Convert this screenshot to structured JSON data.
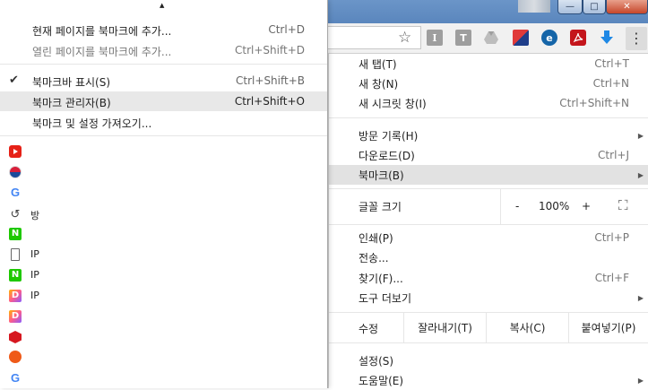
{
  "main_menu": {
    "items": [
      {
        "label": "새 탭(T)",
        "shortcut": "Ctrl+T"
      },
      {
        "label": "새 창(N)",
        "shortcut": "Ctrl+N"
      },
      {
        "label": "새 시크릿 창(I)",
        "shortcut": "Ctrl+Shift+N"
      },
      {
        "label": "방문 기록(H)",
        "shortcut": ""
      },
      {
        "label": "다운로드(D)",
        "shortcut": "Ctrl+J"
      },
      {
        "label": "북마크(B)",
        "shortcut": ""
      }
    ],
    "zoom": {
      "label": "글꼴 크기",
      "minus": "-",
      "value": "100%",
      "plus": "+",
      "fullscreen": "⛶"
    },
    "items2": [
      {
        "label": "인쇄(P)",
        "shortcut": "Ctrl+P"
      },
      {
        "label": "전송...",
        "shortcut": ""
      },
      {
        "label": "찾기(F)...",
        "shortcut": "Ctrl+F"
      },
      {
        "label": "도구 더보기",
        "shortcut": ""
      }
    ],
    "edit": {
      "label": "수정",
      "cut": "잘라내기(T)",
      "copy": "복사(C)",
      "paste": "붙여넣기(P)"
    },
    "items3": [
      {
        "label": "설정(S)"
      },
      {
        "label": "도움말(E)"
      }
    ]
  },
  "bookmark_menu": {
    "items": [
      {
        "label": "현재 페이지를 북마크에 추가...",
        "shortcut": "Ctrl+D"
      },
      {
        "label": "열린 페이지를 북마크에 추가...",
        "shortcut": "Ctrl+Shift+D"
      },
      {
        "label": "북마크바 표시(S)",
        "shortcut": "Ctrl+Shift+B",
        "checked": "✔"
      },
      {
        "label": "북마크 관리자(B)",
        "shortcut": "Ctrl+Shift+O"
      },
      {
        "label": "북마크 및 설정 가져오기...",
        "shortcut": ""
      }
    ],
    "favorites": [
      {
        "icon": "youtube-icon",
        "label": ""
      },
      {
        "icon": "korea-gov-icon",
        "label": ""
      },
      {
        "icon": "google-icon",
        "label": "",
        "glyph": "G"
      },
      {
        "icon": "history-icon",
        "label": "방",
        "glyph": "↺"
      },
      {
        "icon": "naver-icon",
        "label": "",
        "glyph": "N"
      },
      {
        "icon": "document-icon",
        "label": "IP"
      },
      {
        "icon": "naver-icon",
        "label": "IP",
        "glyph": "N"
      },
      {
        "icon": "daum-icon",
        "label": "IP",
        "glyph": "D"
      },
      {
        "icon": "daum-icon",
        "label": "",
        "glyph": "D"
      },
      {
        "icon": "red-hexagon-icon",
        "label": ""
      },
      {
        "icon": "orange-face-icon",
        "label": ""
      },
      {
        "icon": "google-icon",
        "label": "",
        "glyph": "G"
      }
    ]
  },
  "toolbar": {
    "ext_i": "I",
    "ext_t": "T",
    "ext_e": "e",
    "menu_glyph": "⋮",
    "star_glyph": "☆"
  },
  "window": {
    "minimize": "—",
    "maximize": "□",
    "close": "✕"
  }
}
